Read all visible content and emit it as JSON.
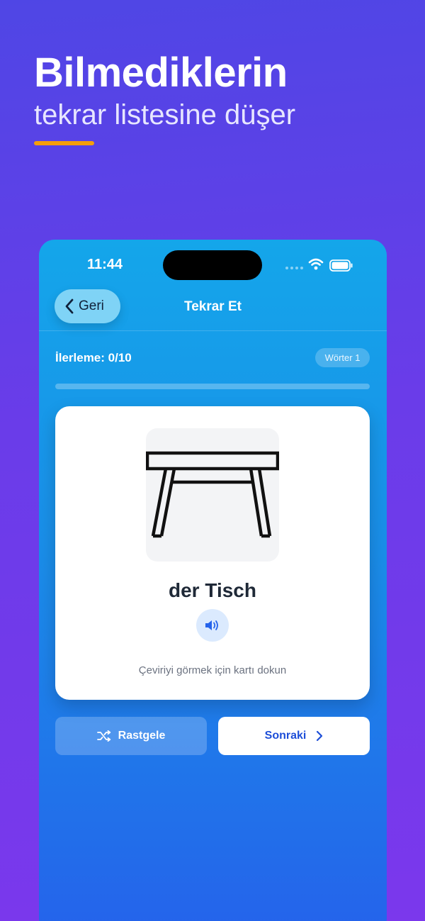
{
  "promo": {
    "headline": "Bilmediklerin",
    "subline": "tekrar listesine düşer",
    "accent_color": "#f59e0b"
  },
  "status_bar": {
    "time": "11:44",
    "icons": [
      "signal-icon",
      "wifi-icon",
      "battery-icon"
    ]
  },
  "nav": {
    "back_label": "Geri",
    "title": "Tekrar Et"
  },
  "progress": {
    "label": "İlerleme: 0/10",
    "current": 0,
    "total": 10,
    "fraction": 0,
    "deck_badge": "Wörter 1"
  },
  "card": {
    "image_icon": "table-icon",
    "word": "der Tisch",
    "speaker_icon": "speaker-icon",
    "hint": "Çeviriyi görmek için kartı dokun"
  },
  "actions": {
    "shuffle_label": "Rastgele",
    "shuffle_icon": "shuffle-icon",
    "next_label": "Sonraki",
    "next_icon": "chevron-right-icon"
  }
}
